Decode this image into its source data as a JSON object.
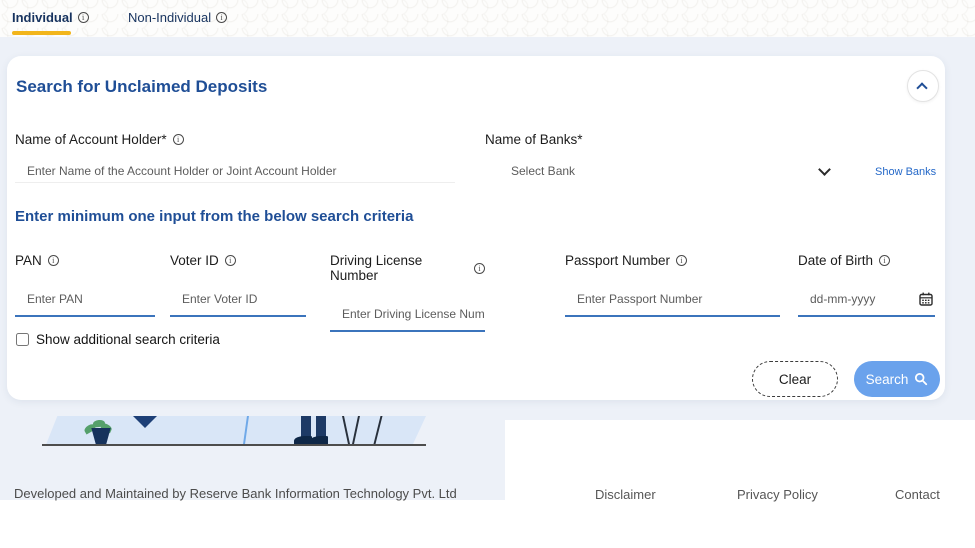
{
  "tabs": {
    "individual": {
      "label": "Individual"
    },
    "non_individual": {
      "label": "Non-Individual"
    }
  },
  "card": {
    "title": "Search for Unclaimed Deposits",
    "account_holder": {
      "label": "Name of Account Holder*",
      "placeholder": "Enter Name of the Account Holder or Joint Account Holder"
    },
    "banks": {
      "label": "Name of Banks*",
      "placeholder": "Select Bank",
      "show_banks": "Show Banks"
    },
    "criteria_heading": "Enter minimum one input from the below search criteria",
    "criteria_fields": [
      {
        "label": "PAN",
        "placeholder": "Enter PAN"
      },
      {
        "label": "Voter ID",
        "placeholder": "Enter Voter ID"
      },
      {
        "label": "Driving License Number",
        "placeholder": "Enter Driving License Number"
      },
      {
        "label": "Passport Number",
        "placeholder": "Enter Passport Number"
      },
      {
        "label": "Date of Birth",
        "placeholder": "dd-mm-yyyy"
      }
    ],
    "additional_criteria_label": "Show additional search criteria",
    "buttons": {
      "clear": "Clear",
      "search": "Search"
    }
  },
  "footer": {
    "credit": "Developed and Maintained by Reserve Bank Information Technology Pvt. Ltd",
    "links": [
      {
        "label": "Disclaimer"
      },
      {
        "label": "Privacy Policy"
      },
      {
        "label": "Contact"
      }
    ]
  },
  "colors": {
    "navy_tab_text": "#17335f",
    "heading_blue": "#1f4e96",
    "tab_underline_yellow": "#f2b51b",
    "field_underline_blue": "#3b74bc",
    "search_button_blue": "#6aa2ec",
    "link_blue": "#2468c8",
    "page_background": "#edf1f8"
  }
}
